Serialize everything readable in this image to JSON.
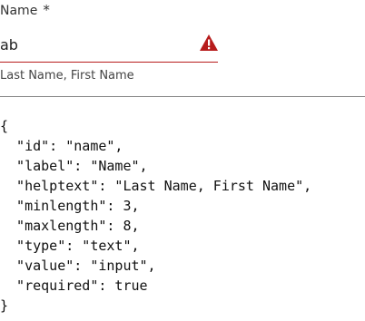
{
  "field": {
    "label": "Name",
    "required_marker": "*",
    "value": "ab",
    "helptext": "Last Name, First Name",
    "status_icon": "warning-icon",
    "error_color": "#b71c1c"
  },
  "code": {
    "lines": [
      "{",
      "  \"id\": \"name\",",
      "  \"label\": \"Name\",",
      "  \"helptext\": \"Last Name, First Name\",",
      "  \"minlength\": 3,",
      "  \"maxlength\": 8,",
      "  \"type\": \"text\",",
      "  \"value\": \"input\",",
      "  \"required\": true",
      "}"
    ]
  }
}
